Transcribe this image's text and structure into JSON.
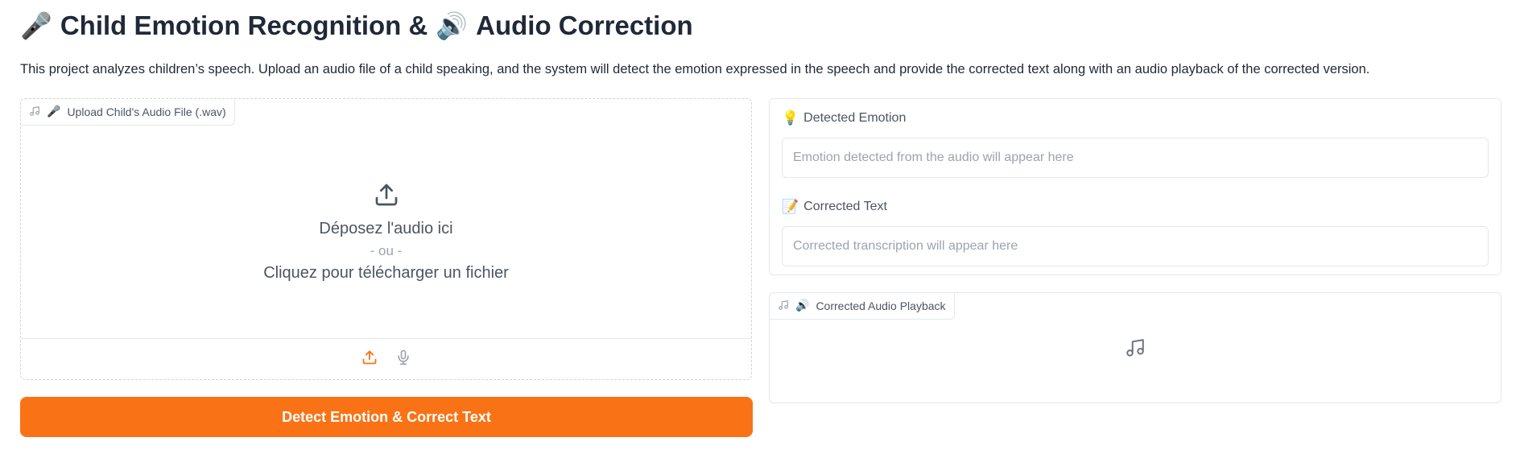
{
  "header": {
    "title_emoji_left": "🎤",
    "title_part1": "Child Emotion Recognition &",
    "title_emoji_mid": "🔊",
    "title_part2": "Audio Correction",
    "description": "This project analyzes children’s speech. Upload an audio file of a child speaking, and the system will detect the emotion expressed in the speech and provide the corrected text along with an audio playback of the corrected version."
  },
  "upload": {
    "label_emoji": "🎤",
    "label": "Upload Child's Audio File (.wav)",
    "drop_text": "Déposez l'audio ici",
    "or_text": "- ou -",
    "click_text": "Cliquez pour télécharger un fichier",
    "icons": [
      "music-note-icon",
      "upload-icon",
      "microphone-icon"
    ]
  },
  "action": {
    "detect_label": "Detect Emotion & Correct Text"
  },
  "outputs": {
    "emotion": {
      "emoji": "💡",
      "label": "Detected Emotion",
      "value": "",
      "placeholder": "Emotion detected from the audio will appear here"
    },
    "corrected_text": {
      "emoji": "📝",
      "label": "Corrected Text",
      "value": "",
      "placeholder": "Corrected transcription will appear here"
    },
    "playback": {
      "emoji": "🔊",
      "label": "Corrected Audio Playback"
    }
  },
  "colors": {
    "accent": "#f97316",
    "text": "#1f2937",
    "muted": "#4b5563",
    "placeholder": "#9ca3af",
    "border": "#e5e7eb"
  }
}
